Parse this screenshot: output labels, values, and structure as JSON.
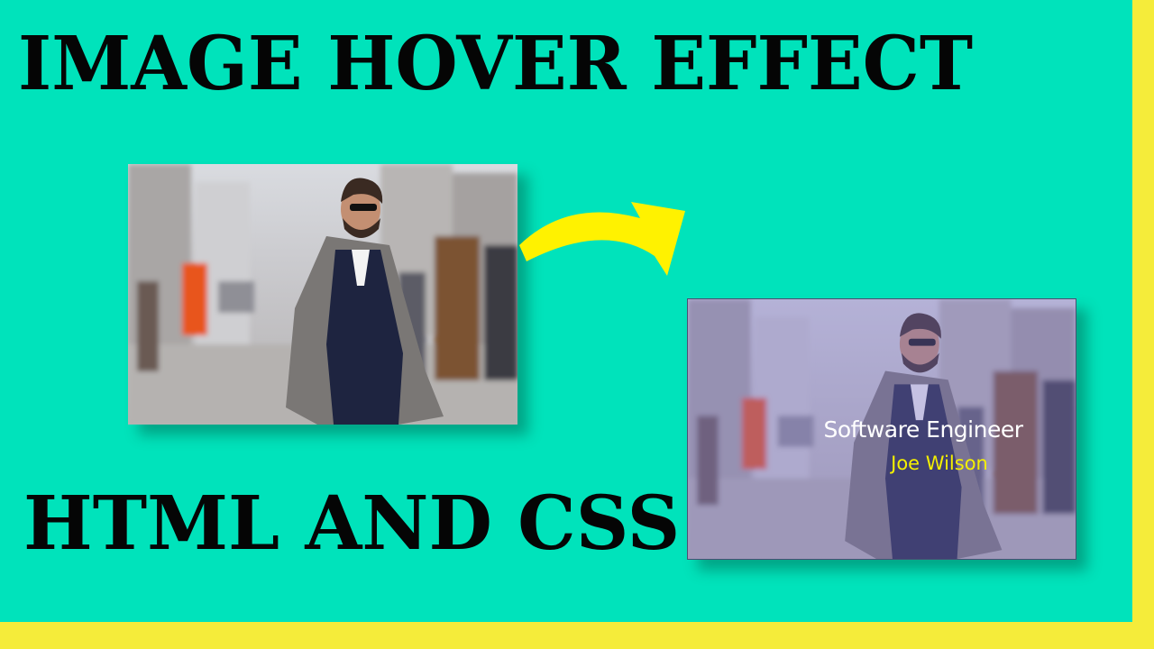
{
  "headline_top": "IMAGE HOVER EFFECT",
  "headline_bottom": "HTML AND CSS",
  "hover_card": {
    "role": "Software Engineer",
    "name": "Joe Wilson"
  },
  "colors": {
    "background": "#00e3bb",
    "frame": "#f5ec3a",
    "arrow": "#fff200",
    "name_text": "#f4f000",
    "headline_text": "#050505"
  },
  "icons": {
    "arrow": "curved-arrow-icon"
  }
}
